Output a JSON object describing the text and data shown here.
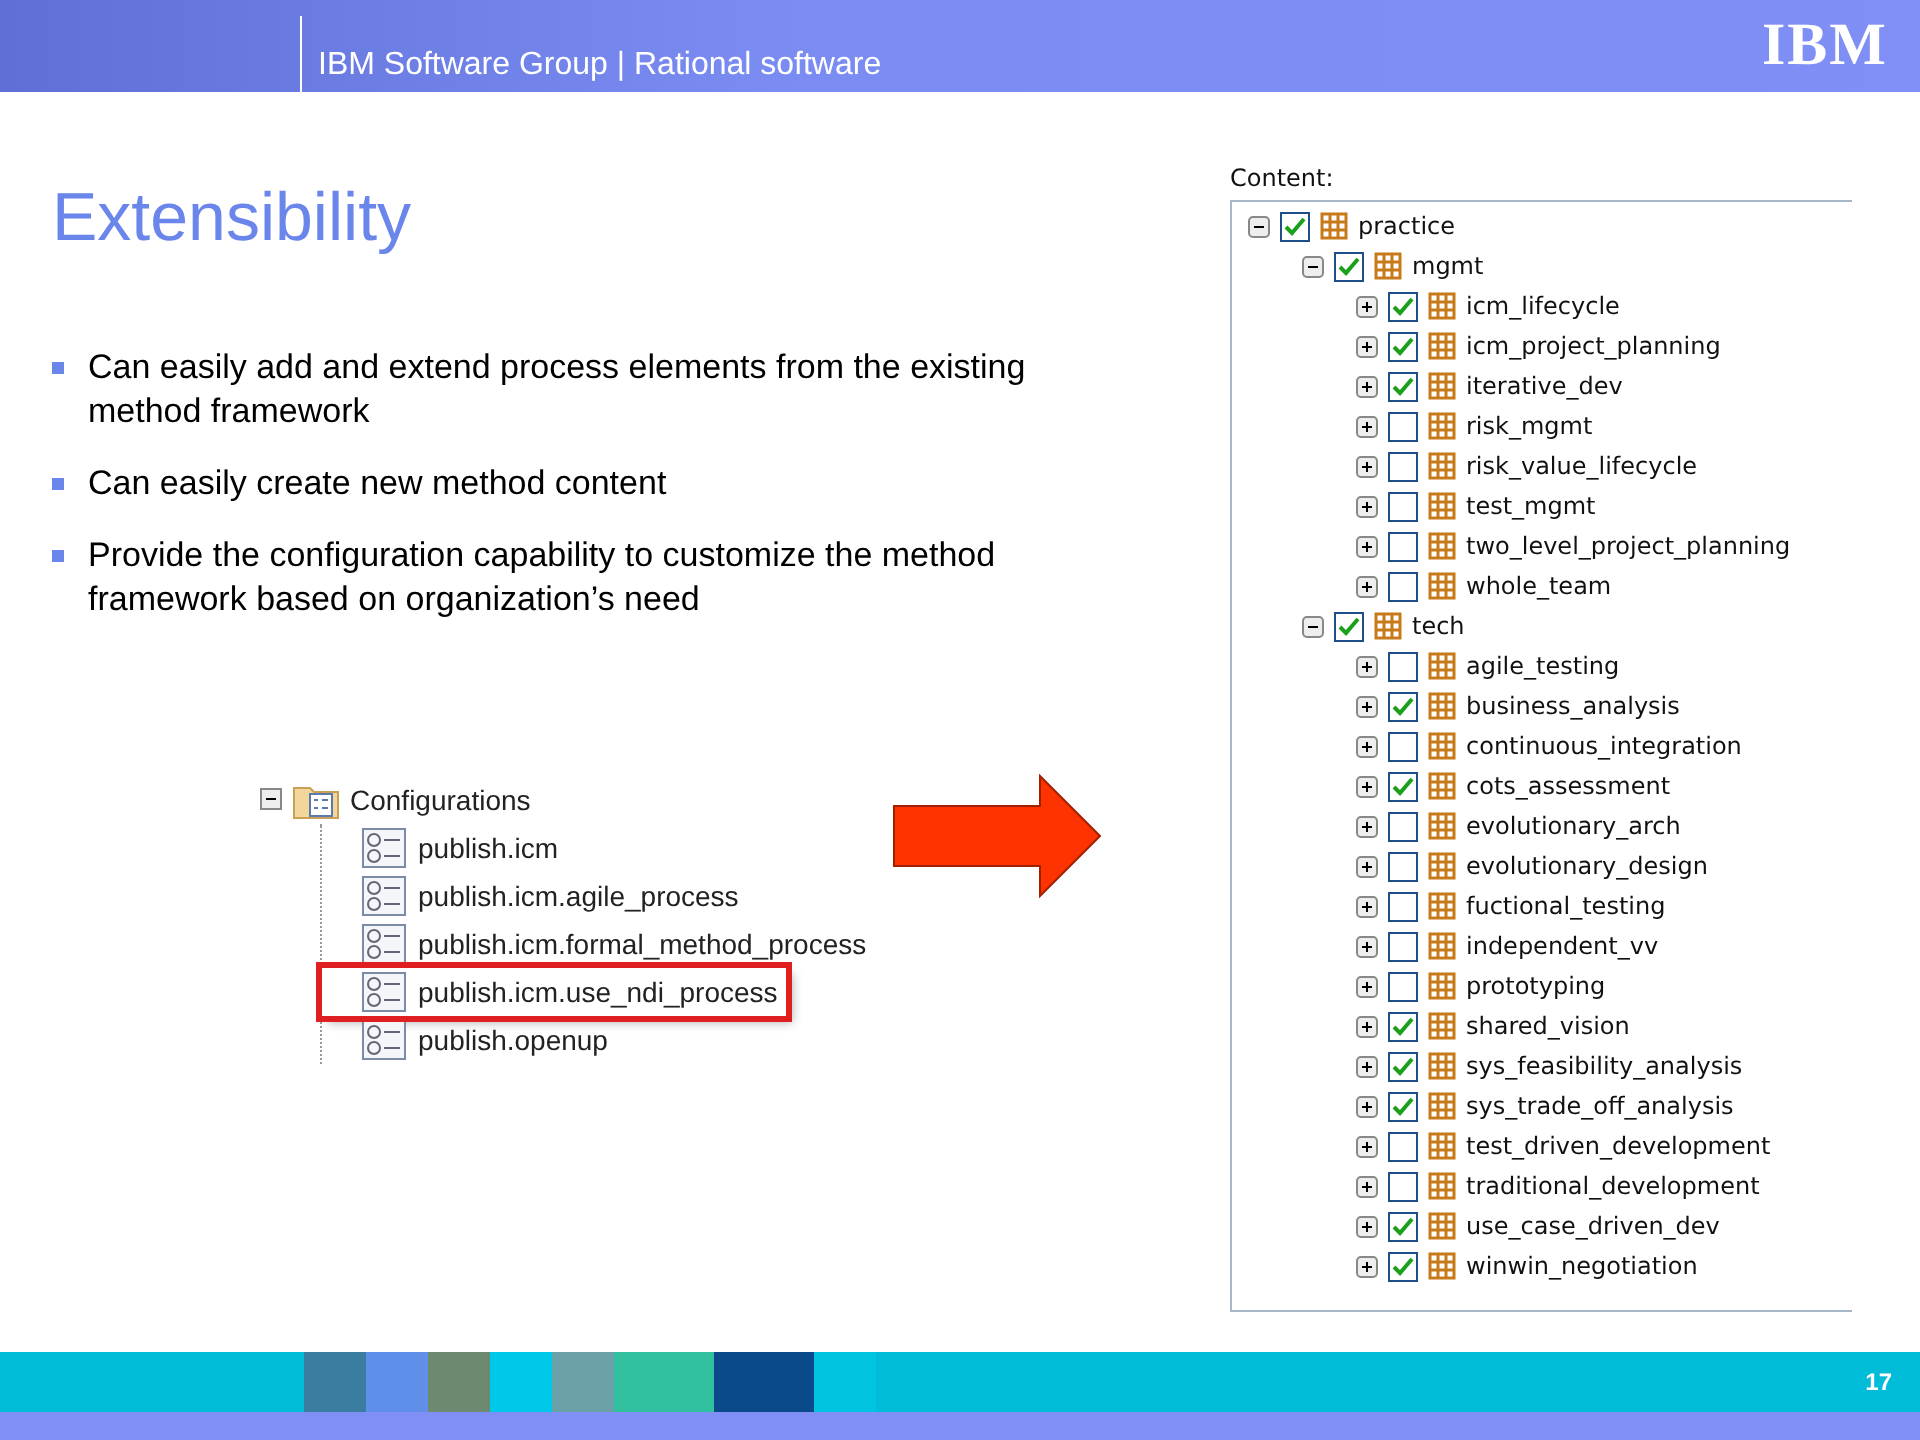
{
  "header": {
    "title": "IBM Software Group | Rational software",
    "logo": "IBM"
  },
  "slide": {
    "title": "Extensibility",
    "bullets": [
      "Can easily add and extend process elements from the existing method framework",
      "Can easily create new method content",
      "Provide the configuration capability to customize the method framework based on organization’s need"
    ]
  },
  "configurations": {
    "label": "Configurations",
    "expanded": true,
    "children": [
      {
        "label": "publish.icm",
        "highlighted": false
      },
      {
        "label": "publish.icm.agile_process",
        "highlighted": false
      },
      {
        "label": "publish.icm.formal_method_process",
        "highlighted": false
      },
      {
        "label": "publish.icm.use_ndi_process",
        "highlighted": true
      },
      {
        "label": "publish.openup",
        "highlighted": false
      }
    ]
  },
  "content": {
    "label": "Content:",
    "tree": [
      {
        "label": "practice",
        "checked": true,
        "expanded": true,
        "children": [
          {
            "label": "mgmt",
            "checked": true,
            "expanded": true,
            "children": [
              {
                "label": "icm_lifecycle",
                "checked": true,
                "expanded": false
              },
              {
                "label": "icm_project_planning",
                "checked": true,
                "expanded": false
              },
              {
                "label": "iterative_dev",
                "checked": true,
                "expanded": false
              },
              {
                "label": "risk_mgmt",
                "checked": false,
                "expanded": false
              },
              {
                "label": "risk_value_lifecycle",
                "checked": false,
                "expanded": false
              },
              {
                "label": "test_mgmt",
                "checked": false,
                "expanded": false
              },
              {
                "label": "two_level_project_planning",
                "checked": false,
                "expanded": false
              },
              {
                "label": "whole_team",
                "checked": false,
                "expanded": false
              }
            ]
          },
          {
            "label": "tech",
            "checked": true,
            "expanded": true,
            "children": [
              {
                "label": "agile_testing",
                "checked": false,
                "expanded": false
              },
              {
                "label": "business_analysis",
                "checked": true,
                "expanded": false
              },
              {
                "label": "continuous_integration",
                "checked": false,
                "expanded": false
              },
              {
                "label": "cots_assessment",
                "checked": true,
                "expanded": false
              },
              {
                "label": "evolutionary_arch",
                "checked": false,
                "expanded": false
              },
              {
                "label": "evolutionary_design",
                "checked": false,
                "expanded": false
              },
              {
                "label": "fuctional_testing",
                "checked": false,
                "expanded": false
              },
              {
                "label": "independent_vv",
                "checked": false,
                "expanded": false
              },
              {
                "label": "prototyping",
                "checked": false,
                "expanded": false
              },
              {
                "label": "shared_vision",
                "checked": true,
                "expanded": false
              },
              {
                "label": "sys_feasibility_analysis",
                "checked": true,
                "expanded": false
              },
              {
                "label": "sys_trade_off_analysis",
                "checked": true,
                "expanded": false
              },
              {
                "label": "test_driven_development",
                "checked": false,
                "expanded": false
              },
              {
                "label": "traditional_development",
                "checked": false,
                "expanded": false
              },
              {
                "label": "use_case_driven_dev",
                "checked": true,
                "expanded": false
              },
              {
                "label": "winwin_negotiation",
                "checked": true,
                "expanded": false
              }
            ]
          }
        ]
      }
    ]
  },
  "footer": {
    "page_number": "17"
  }
}
